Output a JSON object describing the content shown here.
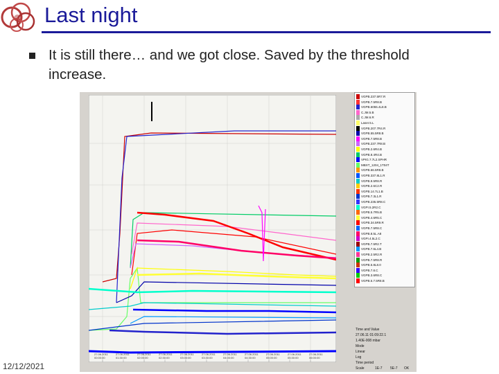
{
  "slide": {
    "title": "Last night",
    "bullet": "It is still there… and we got close. Saved by the threshold increase.",
    "date": "12/12/2021"
  },
  "colors": {
    "title": "#1a1a99",
    "logo": "#b23a3a"
  },
  "screenshot": {
    "x_ticks": [
      "27.06.2011\n00:00:00",
      "27.06.2011\n01:30:00",
      "27.06.2011\n02:00:00",
      "27.06.2011\n02:30:00",
      "27.06.2011\n03:00:00",
      "27.06.2011\n03:30:00",
      "27.06.2011\n04:00:00",
      "27.06.2011\n04:30:00",
      "27.06.2011\n05:00:00",
      "27.06.2011\n05:30:00",
      "27.06.2011\n06:00:00"
    ],
    "legend_items": [
      {
        "label": "VGPB.237.5R7.R",
        "color": "#cc0000"
      },
      {
        "label": "VGPB.7.5R8.B",
        "color": "#ff3333"
      },
      {
        "label": "VGPB.6055.4L8.B",
        "color": "#2222cc"
      },
      {
        "label": "C.JM.5.B",
        "color": "#ff66cc"
      },
      {
        "label": "C.JM.6.R",
        "color": "#aaaaaa"
      },
      {
        "label": "Laser.5.L",
        "color": "#ffff66"
      },
      {
        "label": "VGPB.207.7R4.R",
        "color": "#000000"
      },
      {
        "label": "VGPB.55.5R8.B",
        "color": "#0000aa"
      },
      {
        "label": "VGPB.7.5R8.B",
        "color": "#ff00ff"
      },
      {
        "label": "VGPB.237.7R8.B",
        "color": "#cc66ff"
      },
      {
        "label": "VGPB.2.6R4.B",
        "color": "#ffff00"
      },
      {
        "label": "VGPB.8.4R4.B",
        "color": "#00cc66"
      },
      {
        "label": "VPIG.7.7L2.SPHR",
        "color": "#0000ff"
      },
      {
        "label": "MBXT_1204_1T04T",
        "color": "#66ff66"
      },
      {
        "label": "VGPB.66.5R8.B",
        "color": "#ff9900"
      },
      {
        "label": "VGPB.337.8L1.R",
        "color": "#0055ff"
      },
      {
        "label": "VGPB.9.5R8.R",
        "color": "#00cccc"
      },
      {
        "label": "VGPB.2.6C2.R",
        "color": "#ffcc00"
      },
      {
        "label": "VGPB.14.7L1.B",
        "color": "#ff3300"
      },
      {
        "label": "VGPB.7.3L1.R",
        "color": "#0033cc"
      },
      {
        "label": "VGPB.235.5R8.C",
        "color": "#3333ff"
      },
      {
        "label": "VGPI.5.2R2.C",
        "color": "#00ffcc"
      },
      {
        "label": "VGPB.5.7R5.B",
        "color": "#ff6600"
      },
      {
        "label": "VGPB.4.6R5.C",
        "color": "#ffff33"
      },
      {
        "label": "VGPB.34.5R9.R",
        "color": "#ff0000"
      },
      {
        "label": "VGPB.7.5R8.C",
        "color": "#0066ff"
      },
      {
        "label": "VGPB.8.5L.A8",
        "color": "#ff0066"
      },
      {
        "label": "VGPI.4.5L2.C",
        "color": "#cc00cc"
      },
      {
        "label": "VGPB.7.5R2.T",
        "color": "#990000"
      },
      {
        "label": "VGPB.7.6L4.B",
        "color": "#0099ff"
      },
      {
        "label": "VGPB.2.5R2.R",
        "color": "#ff3399"
      },
      {
        "label": "VGPB.7.5R8.R",
        "color": "#009900"
      },
      {
        "label": "VGPB.5.8L8.0",
        "color": "#cc3300"
      },
      {
        "label": "VGPB.7.8.C",
        "color": "#3300ff"
      },
      {
        "label": "VGPB.3.6R8.C",
        "color": "#00cc00"
      },
      {
        "label": "VGPB.5.7.5R8.B",
        "color": "#ff0000"
      }
    ],
    "controls": {
      "title": "Time and Value",
      "time": "27.06.11 01:09:22.1",
      "value": "1.40E-008 mbar",
      "mode": "Mode",
      "linear": "Linear",
      "log": "Log",
      "time_period": "Time period",
      "scale_label": "Scale",
      "scale_value": "1E-7",
      "limit_value": "5E-7",
      "ok": "OK"
    }
  }
}
